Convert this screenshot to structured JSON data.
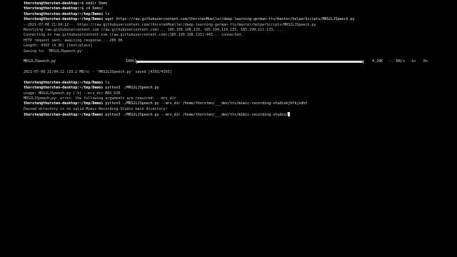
{
  "terminal": {
    "lines": [
      {
        "prompt": "thorsten@thorsten-desktop:",
        "path": "~",
        "command": "$ mkdir Demo"
      },
      {
        "prompt": "thorsten@thorsten-desktop:",
        "path": "~",
        "command": "$ cd Demo/"
      },
      {
        "prompt": "thorsten@thorsten-desktop:",
        "path": "~/tmp/Demo",
        "command": "$ ls"
      },
      {
        "prompt": "thorsten@thorsten-desktop:",
        "path": "~/tmp/Demo",
        "command": "$ wget https://raw.githubusercontent.com/thorstenMueller/deep-learning-german-tts/master/helperScripts/MRS2LJSpeech.py"
      },
      {
        "output": "--2021-07-08 21:04:12--  https://raw.githubusercontent.com/thorstenMueller/deep-learning-german-tts/master/helperScripts/MRS2LJSpeech.py"
      },
      {
        "output": "Resolving raw.githubusercontent.com (raw.githubusercontent.com)... 185.199.108.133, 185.199.110.133, 185.199.111.133, ..."
      },
      {
        "output": "Connecting to raw.githubusercontent.com (raw.githubusercontent.com)|185.199.108.133|:443... connected."
      },
      {
        "output": "HTTP request sent, awaiting response... 200 OK"
      },
      {
        "output": "Length: 4393 (4.3K) [text/plain]"
      },
      {
        "output": "Saving to: 'MRS2LJSpeech.py'"
      },
      {
        "output": ""
      },
      {
        "progress": true
      },
      {
        "output": ""
      },
      {
        "output": "2021-07-08 21:04:12 (29.2 MB/s) - 'MRS2LJSpeech.py' saved [4393/4393]"
      },
      {
        "output": ""
      },
      {
        "prompt": "thorsten@thorsten-desktop:",
        "path": "~/tmp/Demo",
        "command": "$ ls"
      },
      {
        "prompt": "thorsten@thorsten-desktop:",
        "path": "~/tmp/Demo",
        "command": "$ python3 ./MRS2LJSpeech.py"
      },
      {
        "output": "usage: MRS2LJSpeech.py [-h] --mrs_dir MRS_DIR"
      },
      {
        "output": "MRS2LJSpeech.py: error: the following arguments are required: --mrs_dir"
      },
      {
        "prompt": "thorsten@thorsten-desktop:",
        "path": "~/tmp/Demo",
        "command": "$ python3 ./MRS2LJSpeech.py --mrs_dir /home/thorsten/___dev/tts/mimic-recording-studiokjhfkjsdhf"
      },
      {
        "output": "Passed directory is no valid Mimic-Recording-Studio main directory!"
      },
      {
        "prompt": "thorsten@thorsten-desktop:",
        "path": "~/tmp/Demo",
        "command": "$ python3 ./MRS2LJSpeech.py --mrs_dir /home/thorsten/___dev/tts/mimic-recording-studio/",
        "cursor": true
      }
    ],
    "progress": {
      "filename": "MRS2LJSpeech.py",
      "percent_label": "100%[",
      "fraction": 1.0,
      "size": "4.29K",
      "rate": "--.-KB/s",
      "in_label": "in",
      "time": "0s"
    }
  }
}
